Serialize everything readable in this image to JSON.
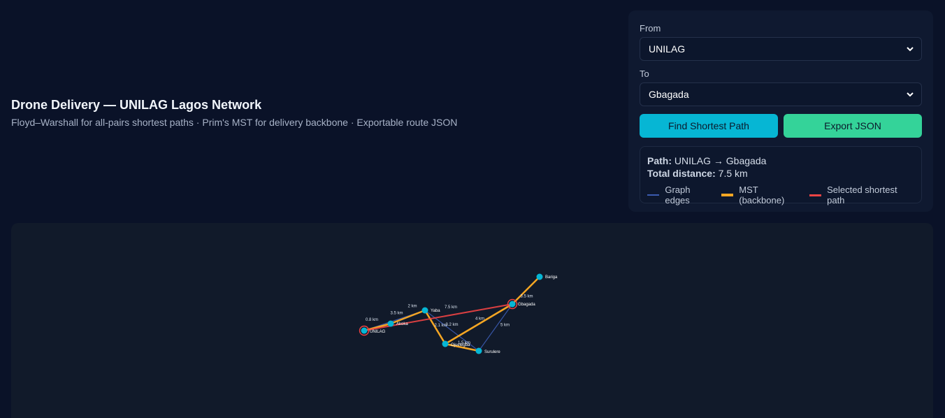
{
  "header": {
    "title": "Drone Delivery — UNILAG Lagos Network",
    "subtitle": "Floyd–Warshall for all-pairs shortest paths · Prim's MST for delivery backbone · Exportable route JSON"
  },
  "controls": {
    "from_label": "From",
    "from_value": "UNILAG",
    "to_label": "To",
    "to_value": "Gbagada",
    "find_button": "Find Shortest Path",
    "export_button": "Export JSON"
  },
  "result": {
    "path_label": "Path:",
    "path_value": "UNILAG → Gbagada",
    "distance_label": "Total distance:",
    "distance_value": "7.5 km"
  },
  "legend": [
    {
      "label": "Graph edges",
      "color": "#3b5bb0"
    },
    {
      "label": "MST (backbone)",
      "color": "#f5a623"
    },
    {
      "label": "Selected shortest path",
      "color": "#ef4444"
    }
  ],
  "graph": {
    "nodes": [
      {
        "id": "UNILAG",
        "label": "UNILAG",
        "selected": true
      },
      {
        "id": "Akoka",
        "label": "Akoka",
        "selected": false
      },
      {
        "id": "Yaba",
        "label": "Yaba",
        "selected": false
      },
      {
        "id": "Ojuelegba",
        "label": "Ojuelegba",
        "selected": false
      },
      {
        "id": "Surulere",
        "label": "Surulere",
        "selected": false
      },
      {
        "id": "Gbagada",
        "label": "Gbagada",
        "selected": true
      },
      {
        "id": "Bariga",
        "label": "Bariga",
        "selected": false
      }
    ],
    "edges": [
      {
        "from": "UNILAG",
        "to": "Akoka",
        "label": "0.8 km",
        "kind": "mst"
      },
      {
        "from": "Akoka",
        "to": "Yaba",
        "label": "3.5 km",
        "kind": "mst"
      },
      {
        "from": "UNILAG",
        "to": "Yaba",
        "label": "2 km",
        "kind": "graph"
      },
      {
        "from": "Yaba",
        "to": "Ojuelegba",
        "label": "2.1 km",
        "kind": "mst"
      },
      {
        "from": "Yaba",
        "to": "Surulere",
        "label": "3.2 km",
        "kind": "graph"
      },
      {
        "from": "Ojuelegba",
        "to": "Surulere",
        "label": "1.5 km",
        "kind": "mst"
      },
      {
        "from": "Ojuelegba",
        "to": "Gbagada",
        "label": "4 km",
        "kind": "mst"
      },
      {
        "from": "Surulere",
        "to": "Gbagada",
        "label": "5 km",
        "kind": "graph"
      },
      {
        "from": "Gbagada",
        "to": "Bariga",
        "label": "3.5 km",
        "kind": "mst"
      },
      {
        "from": "UNILAG",
        "to": "Gbagada",
        "label": "7.5 km",
        "kind": "path"
      }
    ]
  },
  "colors": {
    "node": "#06b6d4",
    "graph_edge": "#3b5bb0",
    "mst_edge": "#f5a623",
    "path_edge": "#ef4444"
  }
}
